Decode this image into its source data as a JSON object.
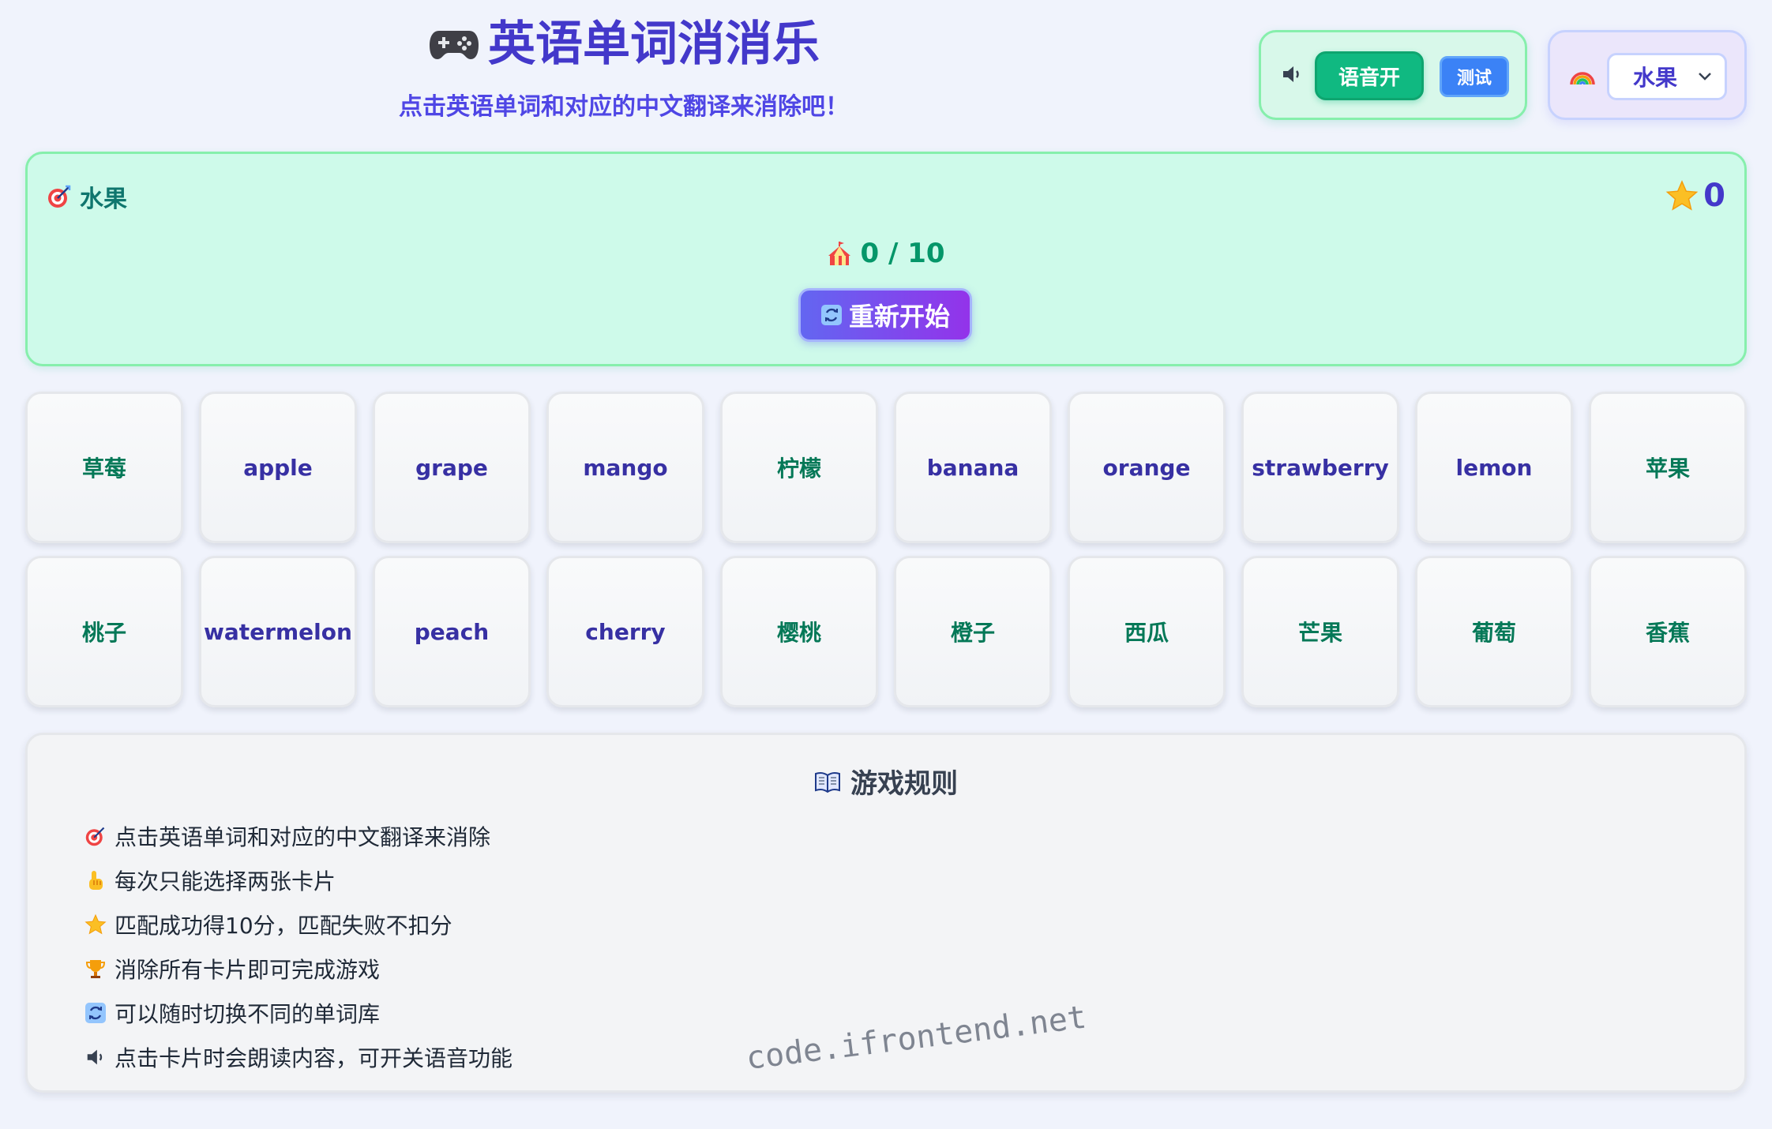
{
  "header": {
    "title": "英语单词消消乐",
    "subtitle": "点击英语单词和对应的中文翻译来消除吧！"
  },
  "voice": {
    "toggle_label": "语音开",
    "test_label": "测试"
  },
  "category_select": {
    "selected": "水果"
  },
  "status": {
    "category": "水果",
    "score": "0",
    "progress": "0 / 10",
    "restart_label": "重新开始"
  },
  "cards": [
    {
      "text": "草莓",
      "lang": "zh"
    },
    {
      "text": "apple",
      "lang": "en"
    },
    {
      "text": "grape",
      "lang": "en"
    },
    {
      "text": "mango",
      "lang": "en"
    },
    {
      "text": "柠檬",
      "lang": "zh"
    },
    {
      "text": "banana",
      "lang": "en"
    },
    {
      "text": "orange",
      "lang": "en"
    },
    {
      "text": "strawberry",
      "lang": "en"
    },
    {
      "text": "lemon",
      "lang": "en"
    },
    {
      "text": "苹果",
      "lang": "zh"
    },
    {
      "text": "桃子",
      "lang": "zh"
    },
    {
      "text": "watermelon",
      "lang": "en"
    },
    {
      "text": "peach",
      "lang": "en"
    },
    {
      "text": "cherry",
      "lang": "en"
    },
    {
      "text": "樱桃",
      "lang": "zh"
    },
    {
      "text": "橙子",
      "lang": "zh"
    },
    {
      "text": "西瓜",
      "lang": "zh"
    },
    {
      "text": "芒果",
      "lang": "zh"
    },
    {
      "text": "葡萄",
      "lang": "zh"
    },
    {
      "text": "香蕉",
      "lang": "zh"
    }
  ],
  "rules": {
    "title": "游戏规则",
    "items": [
      {
        "icon": "target-icon",
        "text": "点击英语单词和对应的中文翻译来消除"
      },
      {
        "icon": "pointing-hand-icon",
        "text": "每次只能选择两张卡片"
      },
      {
        "icon": "star-icon",
        "text": "匹配成功得10分，匹配失败不扣分"
      },
      {
        "icon": "trophy-icon",
        "text": "消除所有卡片即可完成游戏"
      },
      {
        "icon": "refresh-icon",
        "text": "可以随时切换不同的单词库"
      },
      {
        "icon": "speaker-icon",
        "text": "点击卡片时会朗读内容，可开关语音功能"
      }
    ]
  },
  "watermark": "code.ifrontend.net",
  "colors": {
    "english_text": "#3730a3",
    "chinese_text": "#047857",
    "title": "#4338ca",
    "accent_green": "#10b981",
    "accent_blue": "#3b82f6",
    "restart_gradient_start": "#6366f1",
    "restart_gradient_end": "#9333ea"
  }
}
